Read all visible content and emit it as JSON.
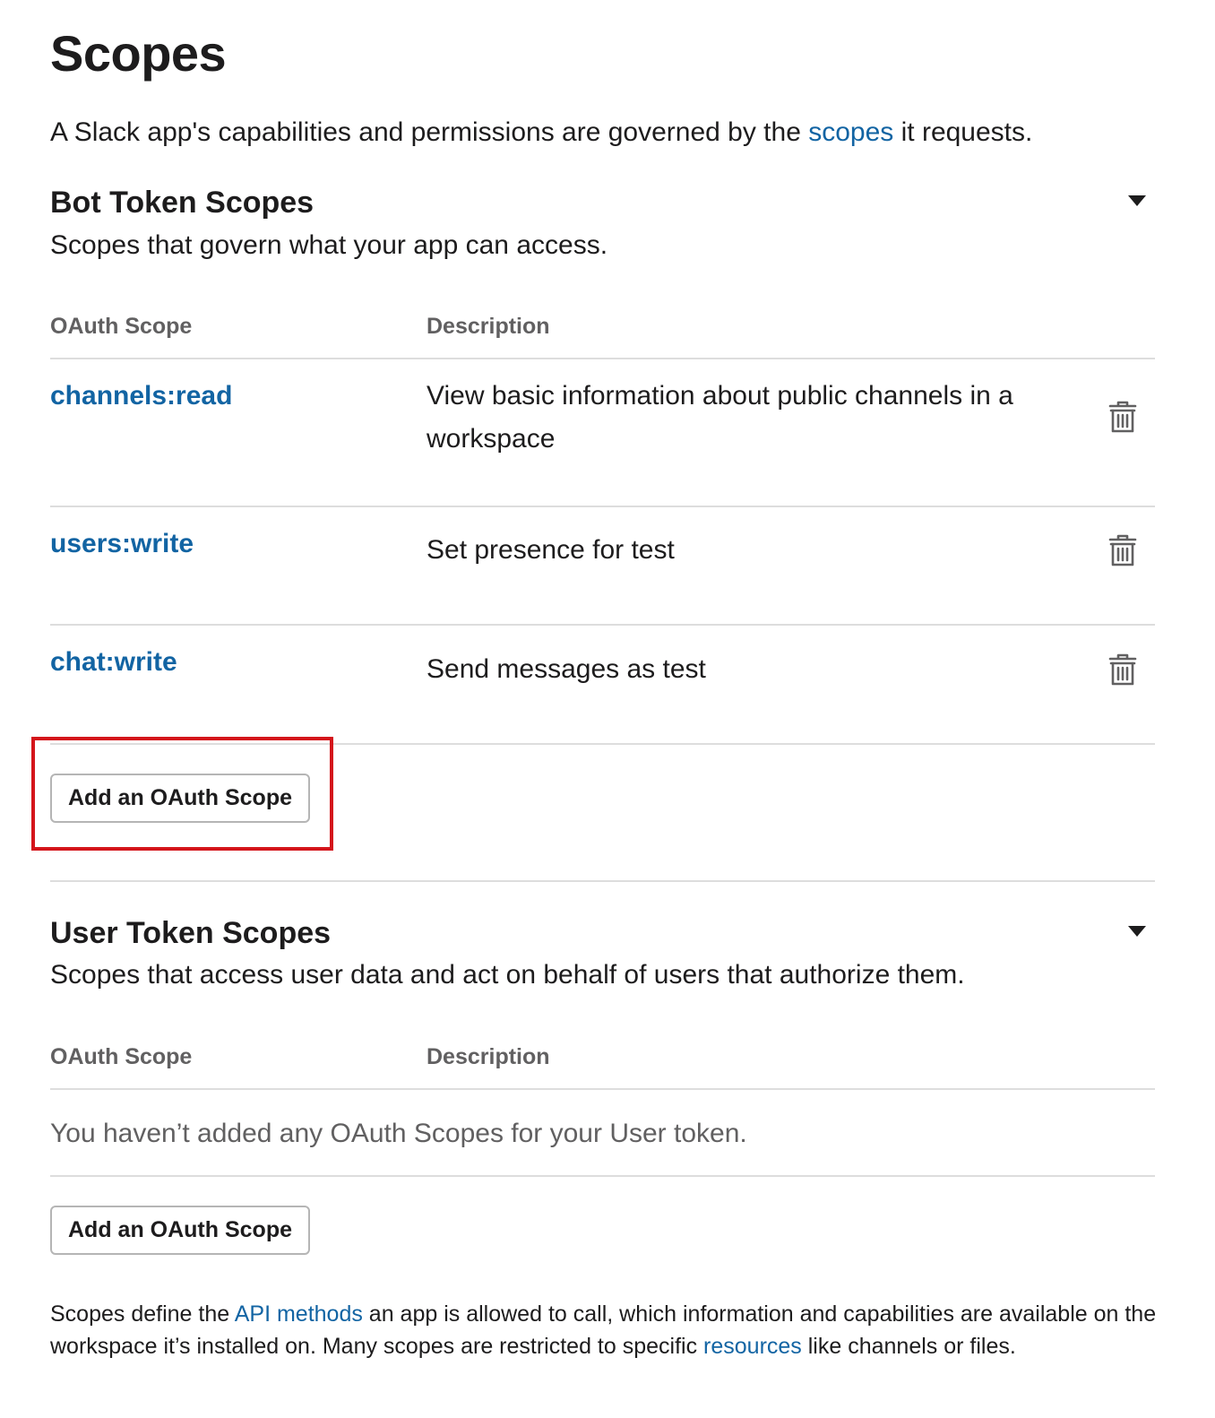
{
  "page": {
    "title": "Scopes",
    "intro_before": "A Slack app's capabilities and permissions are governed by the ",
    "intro_link": "scopes",
    "intro_after": " it requests."
  },
  "bot_section": {
    "title": "Bot Token Scopes",
    "subtitle": "Scopes that govern what your app can access.",
    "col_scope": "OAuth Scope",
    "col_description": "Description",
    "rows": [
      {
        "scope": "channels:read",
        "description": "View basic information about public channels in a workspace"
      },
      {
        "scope": "users:write",
        "description": "Set presence for test"
      },
      {
        "scope": "chat:write",
        "description": "Send messages as test"
      }
    ],
    "add_button": "Add an OAuth Scope"
  },
  "user_section": {
    "title": "User Token Scopes",
    "subtitle": "Scopes that access user data and act on behalf of users that authorize them.",
    "col_scope": "OAuth Scope",
    "col_description": "Description",
    "empty_message": "You haven’t added any OAuth Scopes for your User token.",
    "add_button": "Add an OAuth Scope"
  },
  "footer": {
    "text_1": "Scopes define the ",
    "link_1": "API methods",
    "text_2": " an app is allowed to call, which information and capabilities are available on the workspace it’s installed on. Many scopes are restricted to specific ",
    "link_2": "resources",
    "text_3": " like channels or files."
  },
  "colors": {
    "link": "#1264a3",
    "text": "#1d1c1d",
    "muted": "#616061",
    "highlight": "#d4151b"
  },
  "icons": {
    "row_action": "trash-icon",
    "section_toggle": "caret-down-icon"
  }
}
